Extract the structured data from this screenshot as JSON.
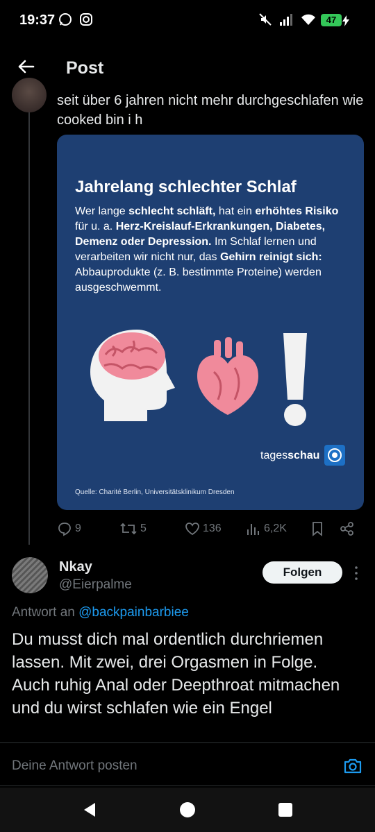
{
  "status": {
    "time": "19:37",
    "battery": "47"
  },
  "header": {
    "title": "Post"
  },
  "post": {
    "text": "seit über 6 jahren nicht mehr durchgeschlafen wie cooked bin i h",
    "card": {
      "title": "Jahrelang schlechter Schlaf",
      "body_parts": [
        {
          "t": "Wer lange ",
          "b": false
        },
        {
          "t": "schlecht schläft,",
          "b": true
        },
        {
          "t": " hat ein ",
          "b": false
        },
        {
          "t": "erhöhtes Risiko",
          "b": true
        },
        {
          "t": " für u. a. ",
          "b": false
        },
        {
          "t": "Herz-Kreislauf-Erkrankungen, Diabetes, Demenz oder Depression.",
          "b": true
        },
        {
          "t": " Im Schlaf lernen und verarbeiten wir nicht nur, das ",
          "b": false
        },
        {
          "t": "Gehirn reinigt sich:",
          "b": true
        },
        {
          "t": " Abbauprodukte (z. B. bestimmte Proteine) werden ausgeschwemmt.",
          "b": false
        }
      ],
      "logo_regular": "tages",
      "logo_bold": "schau",
      "source": "Quelle: Charité Berlin, Universitätsklinikum Dresden"
    },
    "metrics": {
      "replies": "9",
      "reposts": "5",
      "likes": "136",
      "views": "6,2K"
    }
  },
  "reply": {
    "name": "Nkay",
    "handle": "@Eierpalme",
    "follow_label": "Folgen",
    "answer_prefix": "Antwort an",
    "answer_handle": "@backpainbarbiee",
    "text": "Du musst dich mal ordentlich durchriemen lassen. Mit zwei, drei Orgasmen in Folge. Auch ruhig Anal oder Deepthroat mitmachen und du wirst schlafen wie ein Engel"
  },
  "compose": {
    "placeholder": "Deine Antwort posten"
  },
  "icons": {
    "back": "arrow-left-icon",
    "reply": "comment-icon",
    "repost": "repost-icon",
    "like": "heart-icon",
    "views": "bar-chart-icon",
    "bookmark": "bookmark-icon",
    "share": "share-icon",
    "camera": "camera-icon"
  },
  "colors": {
    "card_bg": "#1e3f72",
    "brain_pink": "#f08a9b",
    "link_blue": "#1d9bf0"
  }
}
